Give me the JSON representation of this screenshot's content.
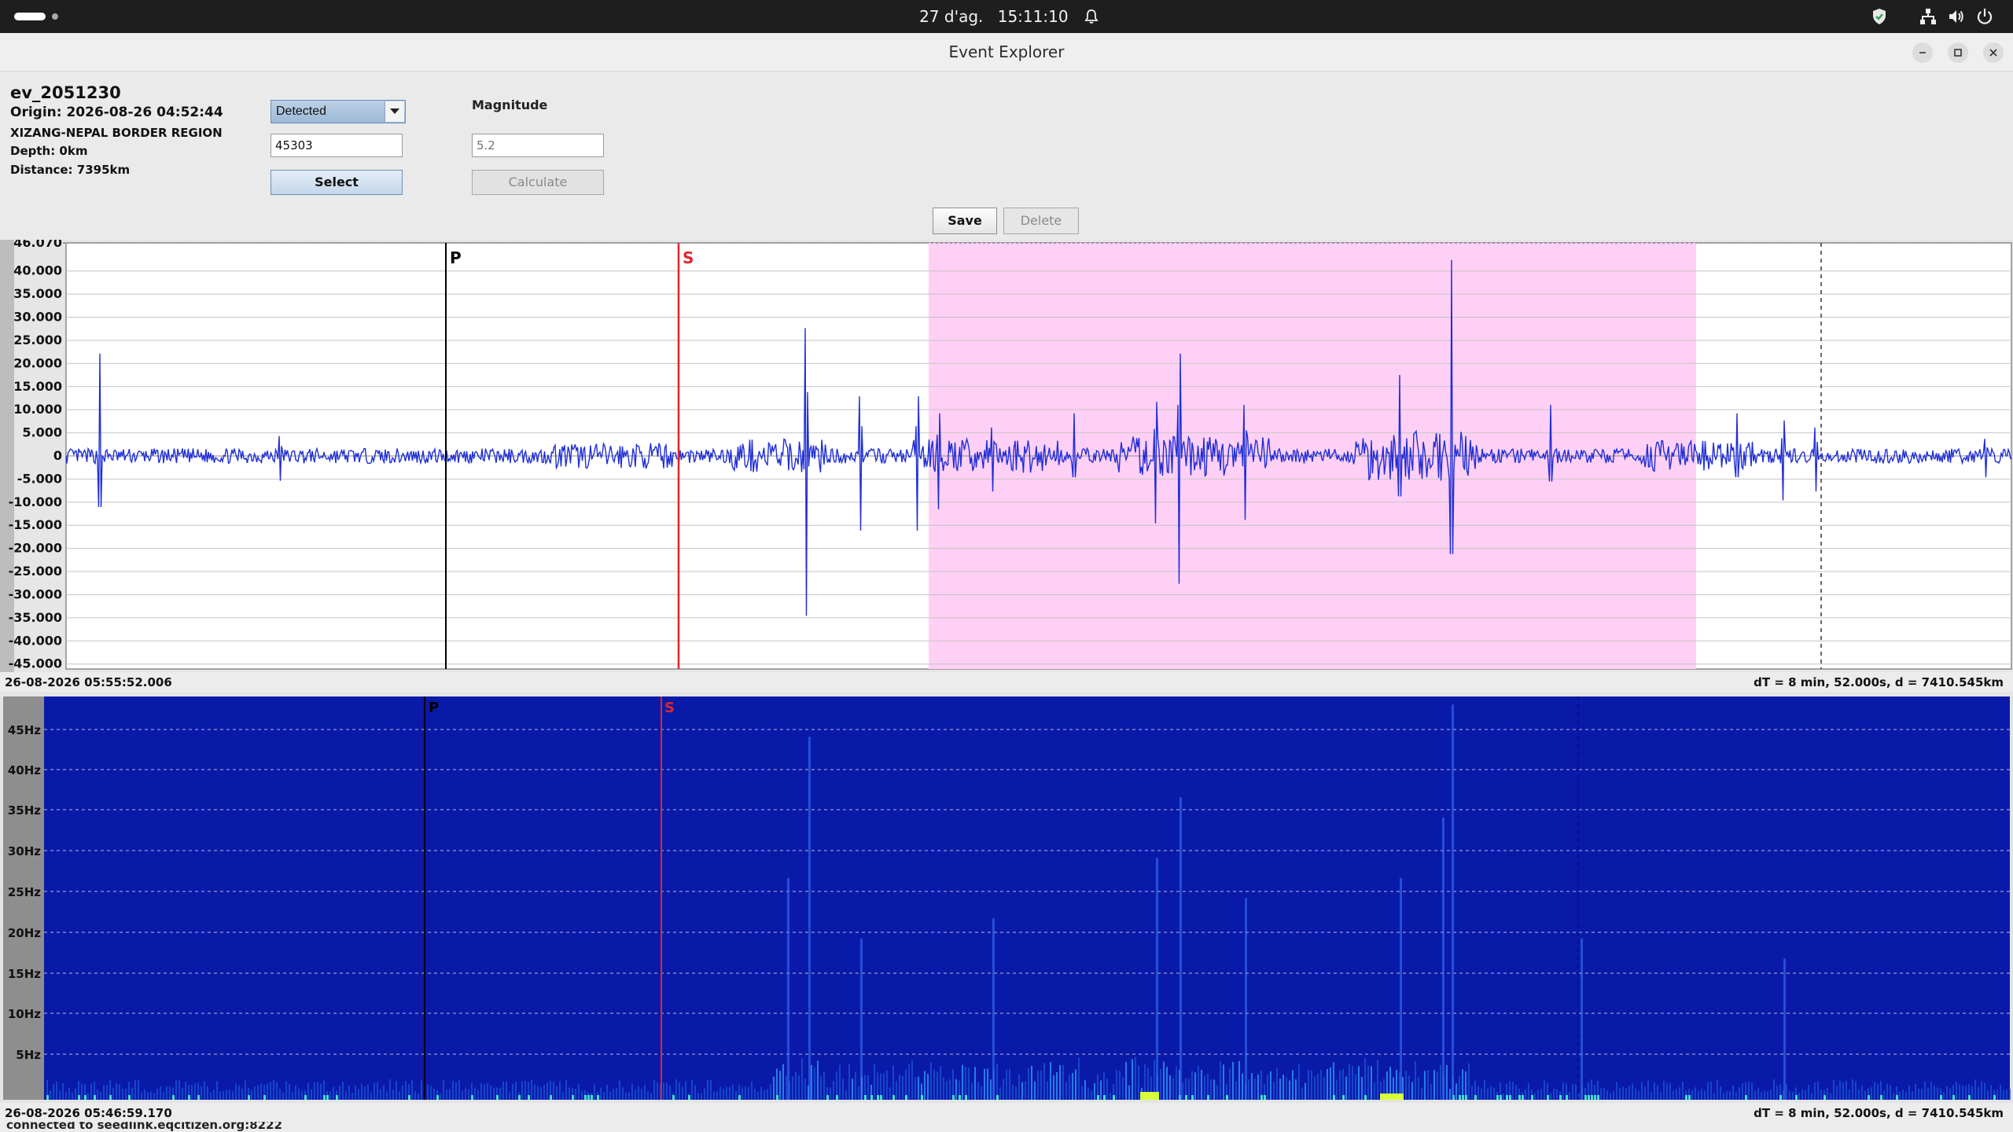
{
  "system_bar": {
    "date": "27 d'ag.",
    "time": "15:11:10"
  },
  "window": {
    "title": "Event Explorer"
  },
  "event": {
    "id": "ev_2051230",
    "origin": "Origin: 2026-08-26 04:52:44",
    "region": "XIZANG-NEPAL BORDER REGION",
    "depth": "Depth: 0km",
    "distance": "Distance: 7395km"
  },
  "controls": {
    "status_selected": "Detected",
    "station_value": "45303",
    "select_label": "Select",
    "magnitude_label": "Magnitude",
    "magnitude_placeholder": "5.2",
    "calculate_label": "Calculate",
    "save_label": "Save",
    "delete_label": "Delete"
  },
  "seismogram": {
    "y_ticks": [
      "46.070",
      "40.000",
      "35.000",
      "30.000",
      "25.000",
      "20.000",
      "15.000",
      "10.000",
      "5.000",
      "0",
      "-5.000",
      "-10.000",
      "-15.000",
      "-20.000",
      "-25.000",
      "-30.000",
      "-35.000",
      "-40.000",
      "-45.000"
    ],
    "y_values": [
      46070,
      40000,
      35000,
      30000,
      25000,
      20000,
      15000,
      10000,
      5000,
      0,
      -5000,
      -10000,
      -15000,
      -20000,
      -25000,
      -30000,
      -35000,
      -40000,
      -45000
    ],
    "ylim": [
      -46070,
      46070
    ],
    "p_label": "P",
    "s_label": "S",
    "start_time": "26-08-2026 05:55:52.006",
    "summary": "dT = 8 min, 52.000s, d = 7410.545km"
  },
  "spectrogram": {
    "freq_ticks": [
      "45Hz",
      "40Hz",
      "35Hz",
      "30Hz",
      "25Hz",
      "20Hz",
      "15Hz",
      "10Hz",
      "5Hz"
    ],
    "p_label": "P",
    "s_label": "S",
    "start_time": "26-08-2026 05:46:59.170",
    "summary": "dT = 8 min, 52.000s, d = 7410.545km"
  },
  "connection_status": "connected to seedlink.eqcitizen.org:8222",
  "colors": {
    "trace": "#1f2ed6",
    "highlight": "#ffd0f6",
    "s_pick": "#e0262b",
    "spectrogram_bg": "#0a1aa8"
  }
}
